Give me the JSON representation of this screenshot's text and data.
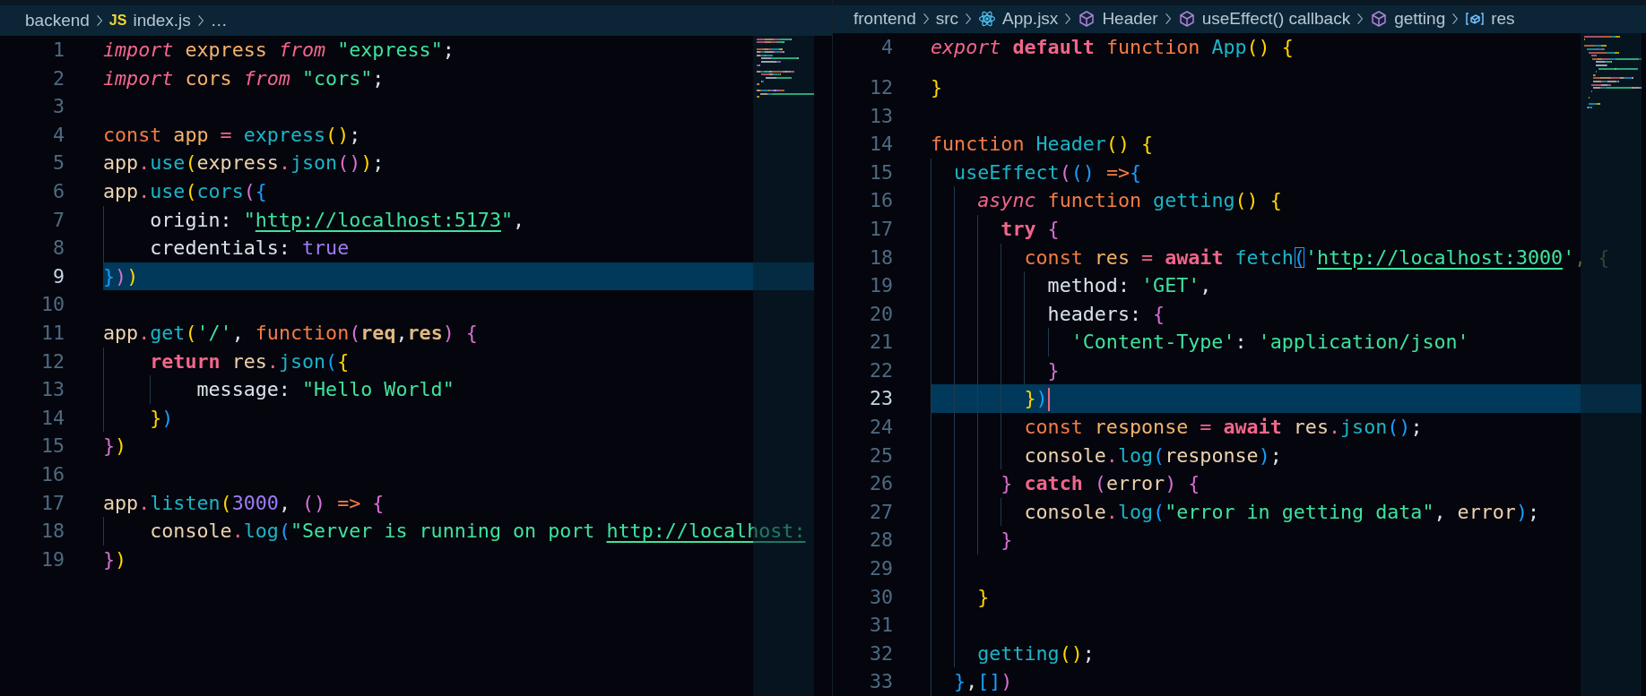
{
  "panes": [
    {
      "focused": false,
      "breadcrumbs": [
        {
          "kind": "folder",
          "label": "backend"
        },
        {
          "kind": "js-file",
          "icon_text": "JS",
          "label": "index.js"
        },
        {
          "kind": "more",
          "label": "…"
        }
      ],
      "lines": [
        {
          "number": "1",
          "selected": false,
          "tokens": [
            {
              "text": "import ",
              "kind": "ki"
            },
            {
              "text": "express ",
              "kind": "decl"
            },
            {
              "text": "from ",
              "kind": "ki"
            },
            {
              "text": "\"express\"",
              "kind": "s"
            },
            {
              "text": ";",
              "kind": "p"
            }
          ]
        },
        {
          "number": "2",
          "selected": false,
          "tokens": [
            {
              "text": "import ",
              "kind": "ki"
            },
            {
              "text": "cors ",
              "kind": "decl"
            },
            {
              "text": "from ",
              "kind": "ki"
            },
            {
              "text": "\"cors\"",
              "kind": "s"
            },
            {
              "text": ";",
              "kind": "p"
            }
          ]
        },
        {
          "number": "3",
          "selected": false
        },
        {
          "number": "4",
          "selected": false,
          "tokens": [
            {
              "text": "const ",
              "kind": "st"
            },
            {
              "text": "app ",
              "kind": "decl"
            },
            {
              "text": "= ",
              "kind": "op"
            },
            {
              "text": "express",
              "kind": "f"
            },
            {
              "text": "()",
              "kind": "b1"
            },
            {
              "text": ";",
              "kind": "p"
            }
          ]
        },
        {
          "number": "5",
          "selected": false,
          "tokens": [
            {
              "text": "app",
              "kind": "var"
            },
            {
              "text": ".",
              "kind": "op"
            },
            {
              "text": "use",
              "kind": "f"
            },
            {
              "text": "(",
              "kind": "b1"
            },
            {
              "text": "express",
              "kind": "var"
            },
            {
              "text": ".",
              "kind": "op"
            },
            {
              "text": "json",
              "kind": "f"
            },
            {
              "text": "()",
              "kind": "b2"
            },
            {
              "text": ")",
              "kind": "b1"
            },
            {
              "text": ";",
              "kind": "p"
            }
          ]
        },
        {
          "number": "6",
          "selected": false,
          "tokens": [
            {
              "text": "app",
              "kind": "var"
            },
            {
              "text": ".",
              "kind": "op"
            },
            {
              "text": "use",
              "kind": "f"
            },
            {
              "text": "(",
              "kind": "b1"
            },
            {
              "text": "cors",
              "kind": "f"
            },
            {
              "text": "(",
              "kind": "b2"
            },
            {
              "text": "{",
              "kind": "b3"
            }
          ]
        },
        {
          "number": "7",
          "selected": false,
          "tokens": [
            {
              "text": "    origin: ",
              "kind": "p"
            },
            {
              "text": "\"",
              "kind": "s"
            },
            {
              "text": "http://localhost:5173",
              "kind": "u"
            },
            {
              "text": "\"",
              "kind": "s"
            },
            {
              "text": ",",
              "kind": "p"
            }
          ]
        },
        {
          "number": "8",
          "selected": false,
          "tokens": [
            {
              "text": "    credentials: ",
              "kind": "p"
            },
            {
              "text": "true",
              "kind": "n"
            }
          ]
        },
        {
          "number": "9",
          "selected": true,
          "tokens": [
            {
              "text": "}",
              "kind": "b3"
            },
            {
              "text": ")",
              "kind": "b2"
            },
            {
              "text": ")",
              "kind": "b1"
            }
          ]
        },
        {
          "number": "10",
          "selected": false
        },
        {
          "number": "11",
          "selected": false,
          "tokens": [
            {
              "text": "app",
              "kind": "var"
            },
            {
              "text": ".",
              "kind": "op"
            },
            {
              "text": "get",
              "kind": "f"
            },
            {
              "text": "(",
              "kind": "b1"
            },
            {
              "text": "'/'",
              "kind": "s"
            },
            {
              "text": ", ",
              "kind": "p"
            },
            {
              "text": "function",
              "kind": "st"
            },
            {
              "text": "(",
              "kind": "b2"
            },
            {
              "text": "req",
              "kind": "pa"
            },
            {
              "text": ",",
              "kind": "p"
            },
            {
              "text": "res",
              "kind": "pa"
            },
            {
              "text": ") ",
              "kind": "b2"
            },
            {
              "text": "{",
              "kind": "b2"
            }
          ]
        },
        {
          "number": "12",
          "selected": false,
          "tokens": [
            {
              "text": "    return ",
              "kind": "kb"
            },
            {
              "text": "res",
              "kind": "var"
            },
            {
              "text": ".",
              "kind": "op"
            },
            {
              "text": "json",
              "kind": "f"
            },
            {
              "text": "(",
              "kind": "b3"
            },
            {
              "text": "{",
              "kind": "b1"
            }
          ]
        },
        {
          "number": "13",
          "selected": false,
          "tokens": [
            {
              "text": "        message: ",
              "kind": "p"
            },
            {
              "text": "\"Hello World\"",
              "kind": "s"
            }
          ]
        },
        {
          "number": "14",
          "selected": false,
          "tokens": [
            {
              "text": "    }",
              "kind": "b1"
            },
            {
              "text": ")",
              "kind": "b3"
            }
          ]
        },
        {
          "number": "15",
          "selected": false,
          "tokens": [
            {
              "text": "}",
              "kind": "b2"
            },
            {
              "text": ")",
              "kind": "b1"
            }
          ]
        },
        {
          "number": "16",
          "selected": false
        },
        {
          "number": "17",
          "selected": false,
          "tokens": [
            {
              "text": "app",
              "kind": "var"
            },
            {
              "text": ".",
              "kind": "op"
            },
            {
              "text": "listen",
              "kind": "f"
            },
            {
              "text": "(",
              "kind": "b1"
            },
            {
              "text": "3000",
              "kind": "n"
            },
            {
              "text": ", ",
              "kind": "p"
            },
            {
              "text": "() ",
              "kind": "b2"
            },
            {
              "text": "=> ",
              "kind": "st"
            },
            {
              "text": "{",
              "kind": "b2"
            }
          ]
        },
        {
          "number": "18",
          "selected": false,
          "tokens": [
            {
              "text": "    console",
              "kind": "var"
            },
            {
              "text": ".",
              "kind": "op"
            },
            {
              "text": "log",
              "kind": "f"
            },
            {
              "text": "(",
              "kind": "b3"
            },
            {
              "text": "\"Server is running on port ",
              "kind": "s"
            },
            {
              "text": "http://localhost:",
              "kind": "u"
            }
          ]
        },
        {
          "number": "19",
          "selected": false,
          "tokens": [
            {
              "text": "}",
              "kind": "b2"
            },
            {
              "text": ")",
              "kind": "b1"
            }
          ]
        }
      ]
    },
    {
      "focused": true,
      "breadcrumbs": [
        {
          "kind": "folder",
          "label": "frontend"
        },
        {
          "kind": "folder",
          "label": "src"
        },
        {
          "kind": "react-file",
          "label": "App.jsx"
        },
        {
          "kind": "symbol",
          "label": "Header"
        },
        {
          "kind": "symbol",
          "label": "useEffect() callback"
        },
        {
          "kind": "symbol",
          "label": "getting"
        },
        {
          "kind": "variable",
          "label": "res"
        }
      ],
      "sticky": {
        "number": "4",
        "tokens": [
          {
            "text": "export ",
            "kind": "ki"
          },
          {
            "text": "default ",
            "kind": "kb"
          },
          {
            "text": "function ",
            "kind": "st"
          },
          {
            "text": "App",
            "kind": "f"
          },
          {
            "text": "() ",
            "kind": "b1"
          },
          {
            "text": "{",
            "kind": "b1"
          }
        ]
      },
      "lines": [
        {
          "number": "12",
          "selected": false,
          "tokens": [
            {
              "text": "}",
              "kind": "b1"
            }
          ]
        },
        {
          "number": "13",
          "selected": false
        },
        {
          "number": "14",
          "selected": false,
          "tokens": [
            {
              "text": "function ",
              "kind": "st"
            },
            {
              "text": "Header",
              "kind": "f"
            },
            {
              "text": "() ",
              "kind": "b1"
            },
            {
              "text": "{",
              "kind": "b1"
            }
          ]
        },
        {
          "number": "15",
          "selected": false,
          "tokens": [
            {
              "text": "  useEffect",
              "kind": "f"
            },
            {
              "text": "(",
              "kind": "b2"
            },
            {
              "text": "() ",
              "kind": "b3"
            },
            {
              "text": "=>",
              "kind": "st"
            },
            {
              "text": "{",
              "kind": "b3"
            }
          ]
        },
        {
          "number": "16",
          "selected": false,
          "tokens": [
            {
              "text": "    async ",
              "kind": "ki"
            },
            {
              "text": "function ",
              "kind": "st"
            },
            {
              "text": "getting",
              "kind": "f"
            },
            {
              "text": "() ",
              "kind": "b1"
            },
            {
              "text": "{",
              "kind": "b1"
            }
          ]
        },
        {
          "number": "17",
          "selected": false,
          "tokens": [
            {
              "text": "      try ",
              "kind": "kb"
            },
            {
              "text": "{",
              "kind": "b2"
            }
          ]
        },
        {
          "number": "18",
          "selected": false,
          "tokens": [
            {
              "text": "        const ",
              "kind": "st"
            },
            {
              "text": "res ",
              "kind": "decl"
            },
            {
              "text": "= ",
              "kind": "op"
            },
            {
              "text": "await ",
              "kind": "kb"
            },
            {
              "text": "fetch",
              "kind": "f"
            },
            {
              "text": "(",
              "kind": "match"
            },
            {
              "text": "'",
              "kind": "s"
            },
            {
              "text": "http://localhost:3000",
              "kind": "u"
            },
            {
              "text": "'",
              "kind": "s"
            },
            {
              "text": ", {",
              "kind": "dim"
            }
          ]
        },
        {
          "number": "19",
          "selected": false,
          "tokens": [
            {
              "text": "          method: ",
              "kind": "p"
            },
            {
              "text": "'GET'",
              "kind": "s"
            },
            {
              "text": ",",
              "kind": "p"
            }
          ]
        },
        {
          "number": "20",
          "selected": false,
          "tokens": [
            {
              "text": "          headers: ",
              "kind": "p"
            },
            {
              "text": "{",
              "kind": "b2"
            }
          ]
        },
        {
          "number": "21",
          "selected": false,
          "tokens": [
            {
              "text": "            'Content-Type'",
              "kind": "s"
            },
            {
              "text": ": ",
              "kind": "p"
            },
            {
              "text": "'application/json'",
              "kind": "s"
            }
          ]
        },
        {
          "number": "22",
          "selected": false,
          "tokens": [
            {
              "text": "          }",
              "kind": "b2"
            }
          ]
        },
        {
          "number": "23",
          "selected": true,
          "tokens": [
            {
              "text": "        }",
              "kind": "b1"
            },
            {
              "text": ")",
              "kind": "b3"
            }
          ]
        },
        {
          "number": "24",
          "selected": false,
          "tokens": [
            {
              "text": "        const ",
              "kind": "st"
            },
            {
              "text": "response ",
              "kind": "decl"
            },
            {
              "text": "= ",
              "kind": "op"
            },
            {
              "text": "await ",
              "kind": "kb"
            },
            {
              "text": "res",
              "kind": "var"
            },
            {
              "text": ".",
              "kind": "op"
            },
            {
              "text": "json",
              "kind": "f"
            },
            {
              "text": "()",
              "kind": "b3"
            },
            {
              "text": ";",
              "kind": "p"
            }
          ]
        },
        {
          "number": "25",
          "selected": false,
          "tokens": [
            {
              "text": "        console",
              "kind": "var"
            },
            {
              "text": ".",
              "kind": "op"
            },
            {
              "text": "log",
              "kind": "f"
            },
            {
              "text": "(",
              "kind": "b3"
            },
            {
              "text": "response",
              "kind": "var"
            },
            {
              "text": ")",
              "kind": "b3"
            },
            {
              "text": ";",
              "kind": "p"
            }
          ]
        },
        {
          "number": "26",
          "selected": false,
          "tokens": [
            {
              "text": "      } ",
              "kind": "b2"
            },
            {
              "text": "catch ",
              "kind": "kb"
            },
            {
              "text": "(",
              "kind": "b2"
            },
            {
              "text": "error",
              "kind": "var"
            },
            {
              "text": ") ",
              "kind": "b2"
            },
            {
              "text": "{",
              "kind": "b2"
            }
          ]
        },
        {
          "number": "27",
          "selected": false,
          "tokens": [
            {
              "text": "        console",
              "kind": "var"
            },
            {
              "text": ".",
              "kind": "op"
            },
            {
              "text": "log",
              "kind": "f"
            },
            {
              "text": "(",
              "kind": "b3"
            },
            {
              "text": "\"error in getting data\"",
              "kind": "s"
            },
            {
              "text": ", ",
              "kind": "p"
            },
            {
              "text": "error",
              "kind": "var"
            },
            {
              "text": ")",
              "kind": "b3"
            },
            {
              "text": ";",
              "kind": "p"
            }
          ]
        },
        {
          "number": "28",
          "selected": false,
          "tokens": [
            {
              "text": "      }",
              "kind": "b2"
            }
          ]
        },
        {
          "number": "29",
          "selected": false
        },
        {
          "number": "30",
          "selected": false,
          "tokens": [
            {
              "text": "    }",
              "kind": "b1"
            }
          ]
        },
        {
          "number": "31",
          "selected": false
        },
        {
          "number": "32",
          "selected": false,
          "tokens": [
            {
              "text": "    getting",
              "kind": "f"
            },
            {
              "text": "()",
              "kind": "b1"
            },
            {
              "text": ";",
              "kind": "p"
            }
          ]
        },
        {
          "number": "33",
          "selected": false,
          "tokens": [
            {
              "text": "  }",
              "kind": "b3"
            },
            {
              "text": ",",
              "kind": "p"
            },
            {
              "text": "[]",
              "kind": "b3"
            },
            {
              "text": ")",
              "kind": "b2"
            }
          ]
        }
      ]
    }
  ]
}
